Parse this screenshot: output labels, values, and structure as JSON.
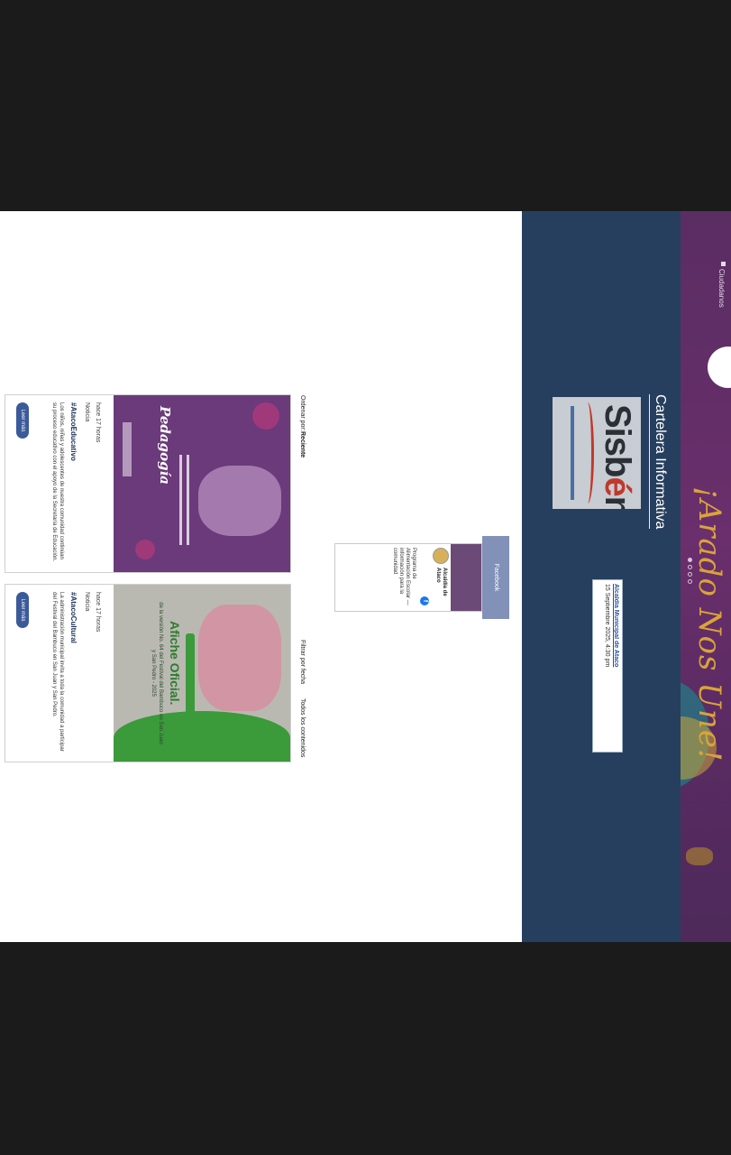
{
  "hero": {
    "nav_label": "Ciudadanos",
    "slogan": "¡Arado Nos Une!",
    "slide_count": 4,
    "active_slide": 1
  },
  "cartelera": {
    "title": "Cartelera Informativa",
    "sisben_logo": "Sisbén",
    "news_link": "Alcaldía Municipal de Ataco",
    "news_text": "15 Septiembre 2025, 4:30 pm"
  },
  "facebook": {
    "label": "Facebook",
    "page_name": "Alcaldía de Ataco",
    "post_text": "Programa de Alimentación Escolar — información para la comunidad"
  },
  "filters": {
    "ordenar_label": "Ordenar por:",
    "ordenar_value": "Reciente",
    "filtrar_label": "Filtrar por fecha",
    "todos_value": "Todos los contenidos"
  },
  "posts": [
    {
      "date": "hace 17 horas",
      "tag": "Noticia",
      "title": "#AtacoEducativo",
      "text": "Los niños, niñas y adolescentes de nuestra comunidad continúan su proceso educativo con el apoyo de la Secretaría de Educación.",
      "button": "Leer más",
      "poster_title": "Pedagogía"
    },
    {
      "date": "hace 17 horas",
      "tag": "Noticia",
      "title": "#AtacoCultural",
      "text": "La administración municipal invita a toda la comunidad a participar del Festival del Bambuco en San Juan y San Pedro.",
      "button": "Leer más",
      "poster_title": "Afiche Oficial.",
      "poster_sub": "de la versión No. 64 del Festival del Bambuco en San Juan y San Pedro - 2025"
    }
  ],
  "colors": {
    "hero_bg": "#5a2d63",
    "slogan": "#d9a33b",
    "cartelera_bg": "#263f5f",
    "facebook": "#1877f2",
    "button": "#3b5a9a"
  }
}
